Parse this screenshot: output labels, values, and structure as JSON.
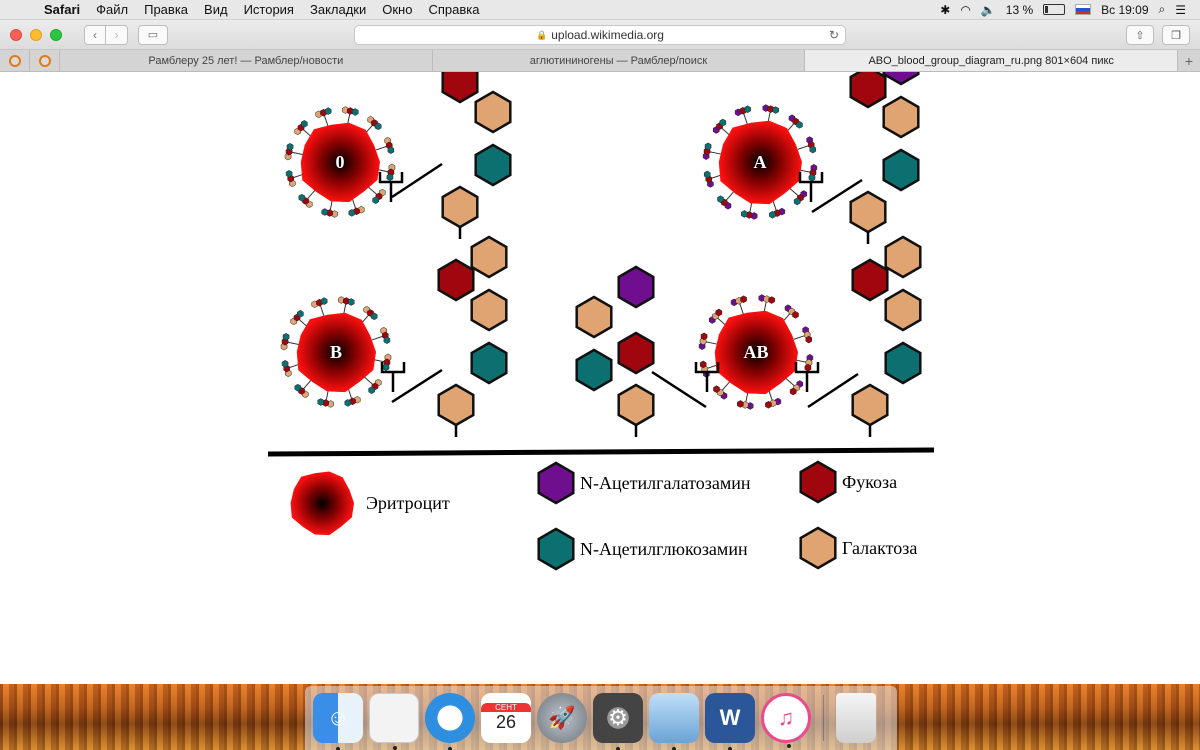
{
  "menubar": {
    "app_name": "Safari",
    "items": [
      "Файл",
      "Правка",
      "Вид",
      "История",
      "Закладки",
      "Окно",
      "Справка"
    ],
    "battery": "13 %",
    "clock": "Вс 19:09"
  },
  "browser": {
    "url": "upload.wikimedia.org",
    "tabs": [
      "Рамблеру 25 лет! — Рамблер/новости",
      "аглютининогены — Рамблер/поиск",
      "ABO_blood_group_diagram_ru.png 801×604 пикс"
    ]
  },
  "diagram": {
    "groups": [
      {
        "label": "0"
      },
      {
        "label": "A"
      },
      {
        "label": "B"
      },
      {
        "label": "AB"
      }
    ],
    "legend": {
      "erythrocyte": "Эритроцит",
      "galnac": "N-Ацетилгалатозамин",
      "glcnac": "N-Ацетилглюкозамин",
      "fucose": "Фукоза",
      "galactose": "Галактоза"
    },
    "colors": {
      "galnac": "#6f0f8f",
      "glcnac": "#0d7070",
      "fucose": "#a0060e",
      "galactose": "#dfa472",
      "erythrocyte": "#ff0000"
    }
  },
  "dock": {
    "calendar_month": "СЕНТ",
    "calendar_day": "26",
    "items": [
      "finder-icon",
      "libreoffice-icon",
      "safari-icon",
      "calendar-icon",
      "launchpad-icon",
      "system-preferences-icon",
      "preview-icon",
      "word-icon",
      "itunes-icon",
      "trash-icon"
    ]
  }
}
